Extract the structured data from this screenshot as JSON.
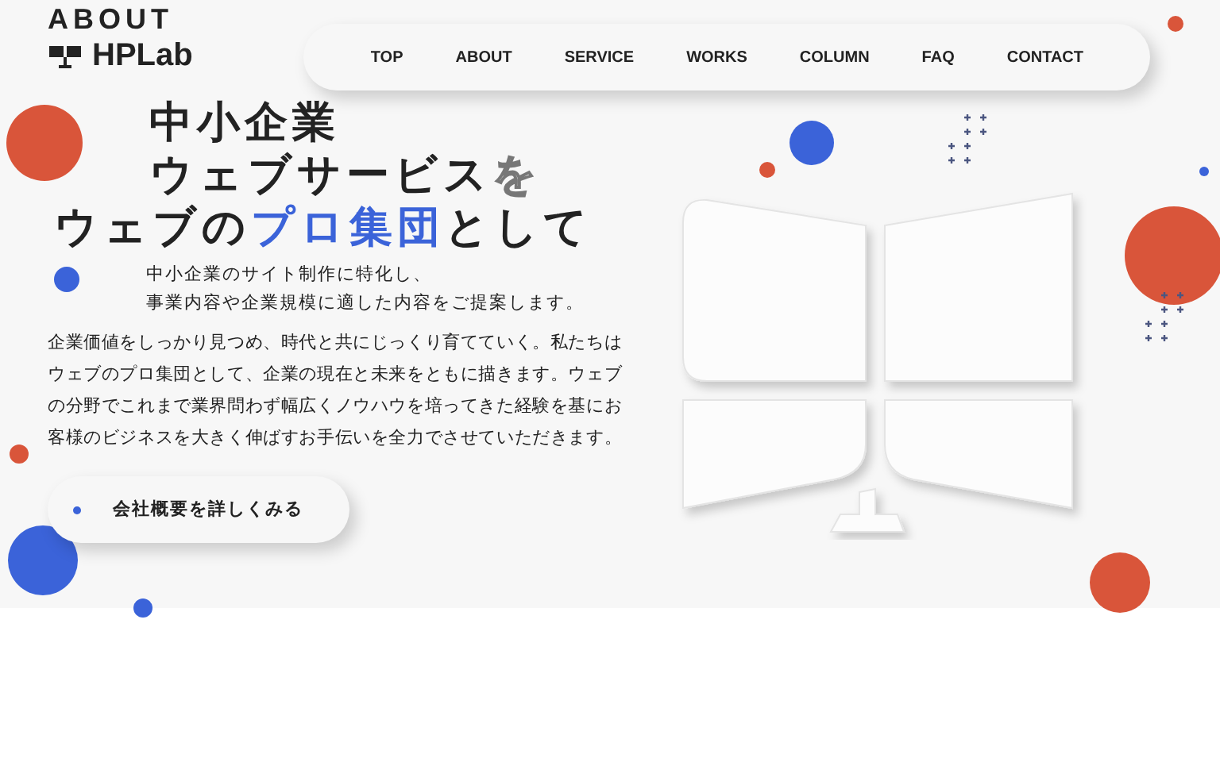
{
  "section_label": "ABOUT",
  "logo": {
    "text": "HPLab"
  },
  "nav": [
    {
      "label": "TOP"
    },
    {
      "label": "ABOUT"
    },
    {
      "label": "SERVICE"
    },
    {
      "label": "WORKS"
    },
    {
      "label": "COLUMN"
    },
    {
      "label": "FAQ"
    },
    {
      "label": "CONTACT"
    }
  ],
  "headline": [
    [
      {
        "text": "中小企業",
        "kind": "plain"
      }
    ],
    [
      {
        "text": "ウェブサービス",
        "kind": "plain"
      },
      {
        "text": "を",
        "kind": "outline"
      }
    ],
    [
      {
        "text": "ウェブの",
        "kind": "plain"
      },
      {
        "text": "プロ集団",
        "kind": "accent"
      },
      {
        "text": "として",
        "kind": "plain"
      }
    ]
  ],
  "lead": [
    "中小企業のサイト制作に特化し、",
    "事業内容や企業規模に適した内容をご提案します。"
  ],
  "body": "企業価値をしっかり見つめ、時代と共にじっくり育てていく。私たちはウェブのプロ集団として、企業の現在と未来をともに描きます。ウェブの分野でこれまで業界問わず幅広くノウハウを培ってきた経験を基にお客様のビジネスを大きく伸ばすお手伝いを全力でさせていただきます。",
  "cta": {
    "label": "会社概要を詳しくみる"
  }
}
